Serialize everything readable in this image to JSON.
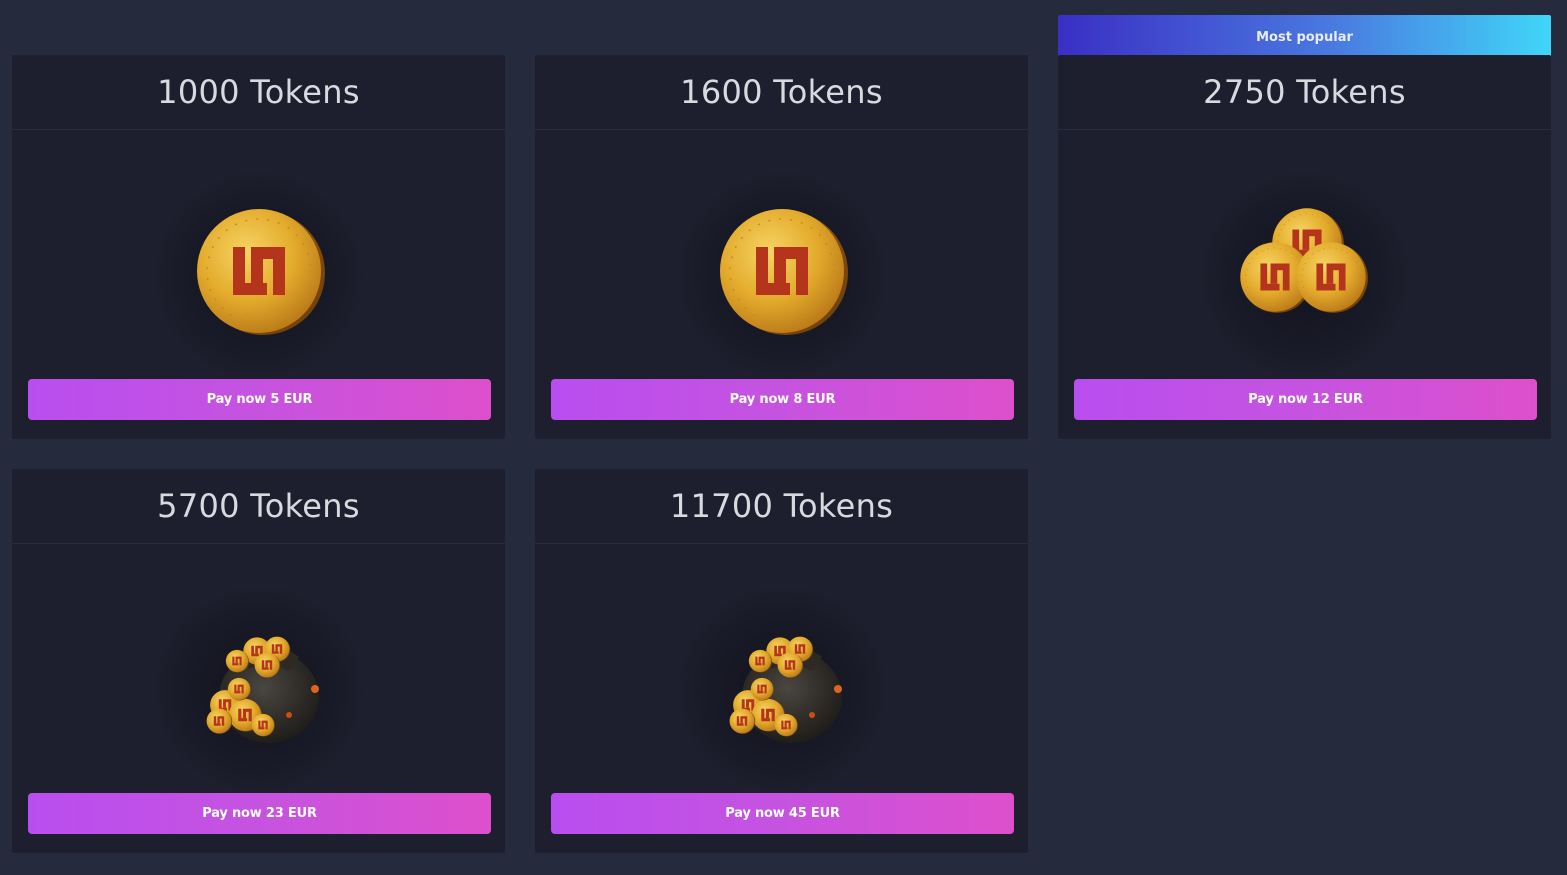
{
  "badge": {
    "label": "Most popular"
  },
  "packages": [
    {
      "title": "1000 Tokens",
      "button": "Pay now 5 EUR",
      "icon": "single-coin-icon"
    },
    {
      "title": "1600 Tokens",
      "button": "Pay now 8 EUR",
      "icon": "single-coin-icon"
    },
    {
      "title": "2750 Tokens",
      "button": "Pay now 12 EUR",
      "icon": "three-coins-icon"
    },
    {
      "title": "5700 Tokens",
      "button": "Pay now 23 EUR",
      "icon": "coin-bag-icon"
    },
    {
      "title": "11700 Tokens",
      "button": "Pay now 45 EUR",
      "icon": "coin-bag-icon"
    }
  ],
  "colors": {
    "background": "#252a3d",
    "card": "#1e1f2e",
    "button_gradient": [
      "#b94ef0",
      "#dd4fcc"
    ],
    "badge_gradient": [
      "#3a2fc4",
      "#40d6f8"
    ],
    "coin": "#e0a92a",
    "coin_emblem": "#b5341c"
  }
}
